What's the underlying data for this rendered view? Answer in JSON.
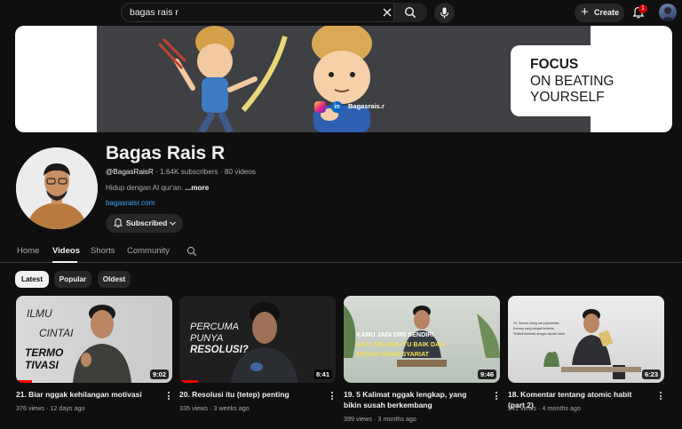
{
  "search": {
    "query": "bagas rais r"
  },
  "topbar": {
    "create_label": "Create",
    "notification_count": "1"
  },
  "banner": {
    "handle": "Bagasrais.r",
    "headline_bold": "FOCUS",
    "headline_line2": "ON BEATING",
    "headline_line3": "YOURSELF"
  },
  "channel": {
    "name": "Bagas Rais R",
    "handle": "@BagasRaisR",
    "stats": " · 1.64K subscribers · 80 videos",
    "description": "Hidup dengan Al qur'an.",
    "more": " ...more",
    "link": "bagasraisr.com",
    "subscribe_label": "Subscribed"
  },
  "tabs": [
    {
      "label": "Home"
    },
    {
      "label": "Videos"
    },
    {
      "label": "Shorts"
    },
    {
      "label": "Community"
    }
  ],
  "chips": [
    {
      "label": "Latest"
    },
    {
      "label": "Popular"
    },
    {
      "label": "Oldest"
    }
  ],
  "videos": [
    {
      "title": "21. Biar nggak kehilangan motivasi",
      "meta": "376 views · 12 days ago",
      "duration": "9:02",
      "thumb_text": [
        "ILMU",
        "CINTAI",
        "TERMO",
        "TIVASI"
      ],
      "progress": 0.1
    },
    {
      "title": "20. Resolusi itu (tetep) penting",
      "meta": "335 views · 3 weeks ago",
      "duration": "8:41",
      "thumb_text": [
        "PERCUMA",
        "PUNYA",
        "RESOLUSI?"
      ],
      "progress": 0.12
    },
    {
      "title": "19. 5 Kalimat nggak lengkap, yang bikin susah berkembang",
      "meta": "399 views · 3 months ago",
      "duration": "9:46",
      "thumb_text": [
        "KAMU JADI DIRI SENDIRI",
        "AJA! SELAMA ITU BAIK DAN",
        "SESUAI SAMA SYARIAT"
      ],
      "progress": 0
    },
    {
      "title": "18. Komentar tentang atomic habit (part 2)",
      "meta": "241 views · 4 months ago",
      "duration": "6:23",
      "thumb_text": [
        "03. Semua orang cari popularitas",
        "Konsep yang sangat berbeda",
        "Terlihat berbeda dengan atomic habit"
      ],
      "progress": 0
    }
  ]
}
